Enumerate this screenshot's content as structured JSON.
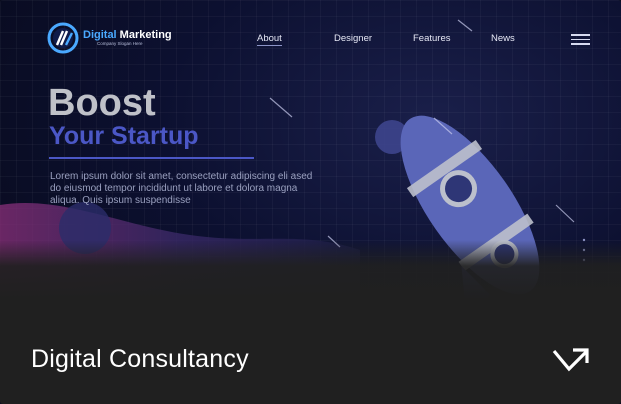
{
  "logo": {
    "title_accent": "Digital",
    "title_rest": " Marketing",
    "tagline": "Company Slogan Here"
  },
  "nav": {
    "items": [
      "About",
      "Designer",
      "Features",
      "News"
    ],
    "active": "About",
    "menu_icon": "hamburger-menu-icon"
  },
  "hero": {
    "title": "Boost",
    "subtitle": "Your Startup",
    "body": "Lorem ipsum dolor sit amet, consectetur adipiscing eli ased do eiusmod tempor incididunt ut labore et dolora magna aliqua. Quis ipsum suspendisse"
  },
  "card": {
    "caption": "Digital Consultancy",
    "action_icon": "arrow-up-right-icon"
  },
  "colors": {
    "background": "#0b0e1f",
    "accent": "#4b57c6",
    "logo_blue": "#4aa9ff",
    "overlay": "#202020"
  }
}
